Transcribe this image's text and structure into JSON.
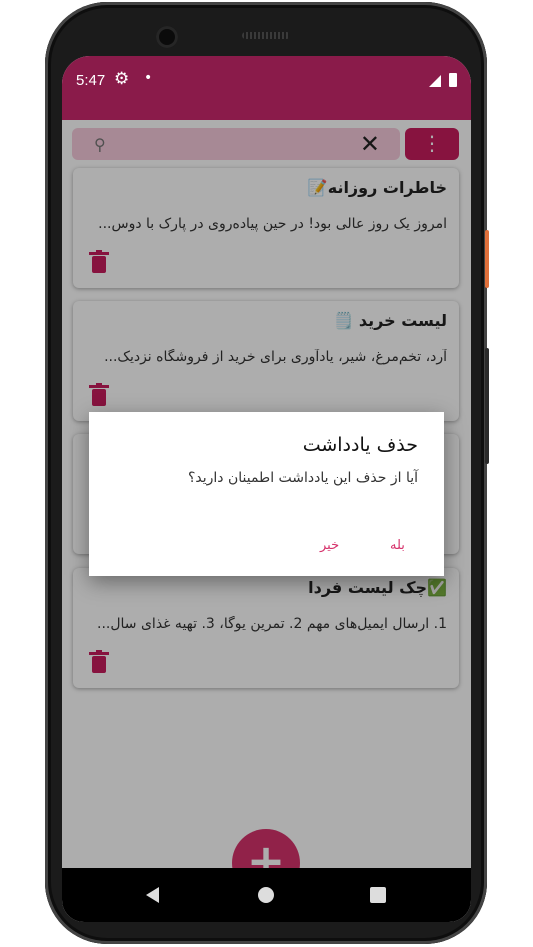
{
  "status_bar": {
    "time": "5:47",
    "icons": [
      "gear-icon",
      "notification-dot",
      "signal-icon",
      "battery-icon"
    ]
  },
  "search": {
    "placeholder": "",
    "value": ""
  },
  "notes": [
    {
      "title": "خاطرات روزانه📝",
      "body": "امروز یک روز عالی بود! در حین پیاده‌روی در پارک با دوس..."
    },
    {
      "title": "لیست خرید 🗒️",
      "body": "آرد، تخم‌مرغ، شیر، یادآوری برای خرید از فروشگاه نزدیک..."
    },
    {
      "title": "",
      "body": ""
    },
    {
      "title": "✅چک لیست فردا",
      "body": "1. ارسال ایمیل‌های مهم 2. تمرین یوگا، 3. تهیه غذای سال..."
    }
  ],
  "fab": {
    "label": "+"
  },
  "dialog": {
    "title": "حذف یادداشت",
    "message": "آیا از حذف این یادداشت اطمینان دارید؟",
    "confirm_label": "بله",
    "cancel_label": "خیر"
  },
  "colors": {
    "primary": "#8a1b4a",
    "accent": "#d6336c",
    "search_bg": "#f7cbdc"
  }
}
